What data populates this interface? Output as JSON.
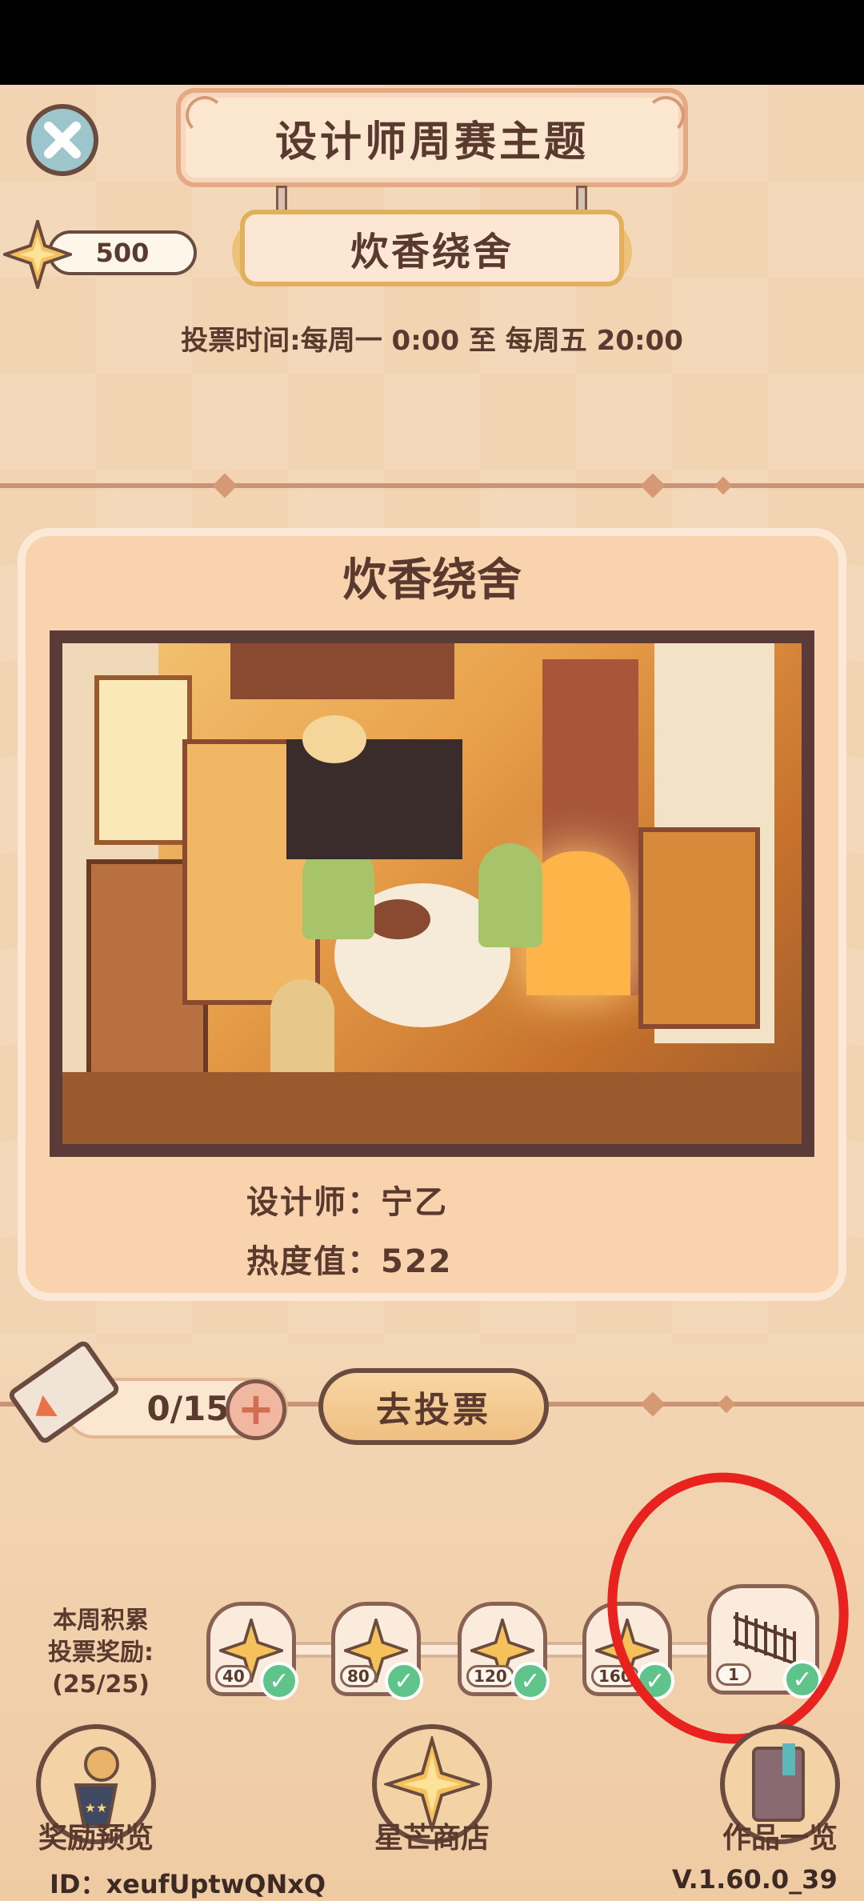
{
  "header": {
    "title": "设计师周赛主题",
    "theme": "炊香绕舍",
    "vote_time": "投票时间:每周一 0:00 至 每周五 20:00",
    "star_count": "500"
  },
  "card": {
    "title": "炊香绕舍",
    "designer_line": "设计师：宁乙",
    "heat_line": "热度值：522"
  },
  "vote": {
    "tickets": "0/15",
    "plus": "+",
    "vote_button": "去投票"
  },
  "rewards": {
    "label_line1": "本周积累",
    "label_line2": "投票奖励:",
    "label_line3": "(25/25)",
    "items": [
      {
        "count": "40",
        "claimed": true
      },
      {
        "count": "80",
        "claimed": true
      },
      {
        "count": "120",
        "claimed": true
      },
      {
        "count": "160",
        "claimed": true
      },
      {
        "count": "1",
        "claimed": true
      }
    ]
  },
  "nav": {
    "reward_preview": "奖励预览",
    "star_shop": "星芒商店",
    "works_overview": "作品一览"
  },
  "footer": {
    "id": "ID：xeufUptwQNxQ",
    "version": "V.1.60.0_39"
  },
  "colors": {
    "text": "#5a3a2e",
    "accent_red_annotation": "#e8231f",
    "check_green": "#5fc48a"
  },
  "icons": [
    "close-icon",
    "star-icon",
    "ticket-icon",
    "plus-icon",
    "check-icon",
    "fence-icon",
    "trophy-icon",
    "compass-star-icon",
    "book-icon"
  ]
}
